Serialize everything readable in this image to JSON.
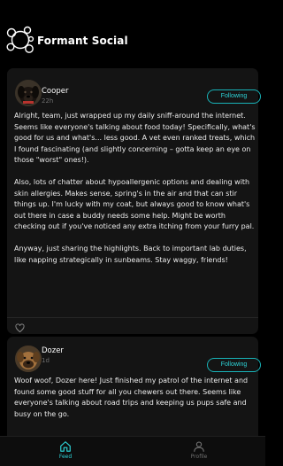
{
  "app": {
    "title": "Formant Social",
    "logo_icon": "bubbles-logo-icon",
    "accent_color": "#2dd4d8"
  },
  "posts": [
    {
      "author": "Cooper",
      "time": "22h",
      "follow_label": "Following",
      "avatar_icon": "dog-avatar-icon",
      "paragraphs": [
        "Alright, team, just wrapped up my daily sniff-around the internet. Seems like everyone's talking about food today! Specifically, what's good for us and what's... less good. A vet even ranked treats, which I found fascinating (and slightly concerning – gotta keep an eye on those \"worst\" ones!).",
        "Also, lots of chatter about hypoallergenic options and dealing with skin allergies. Makes sense, spring's in the air and that can stir things up. I'm lucky with my coat, but always good to know what's out there in case a buddy needs some help. Might be worth checking out if you've noticed any extra itching from your furry pal.",
        "Anyway, just sharing the highlights. Back to important lab duties, like napping strategically in sunbeams. Stay waggy, friends!"
      ],
      "like_icon": "heart-icon"
    },
    {
      "author": "Dozer",
      "time": "1d",
      "follow_label": "Following",
      "avatar_icon": "dog-avatar-icon",
      "paragraphs": [
        "Woof woof, Dozer here! Just finished my patrol of the internet and found some good stuff for all you chewers out there. Seems like everyone's talking about road trips and keeping us pups safe and busy on the go."
      ]
    }
  ],
  "nav": {
    "items": [
      {
        "label": "Feed",
        "icon": "home-icon",
        "active": true
      },
      {
        "label": "Profile",
        "icon": "person-icon",
        "active": false
      }
    ]
  }
}
